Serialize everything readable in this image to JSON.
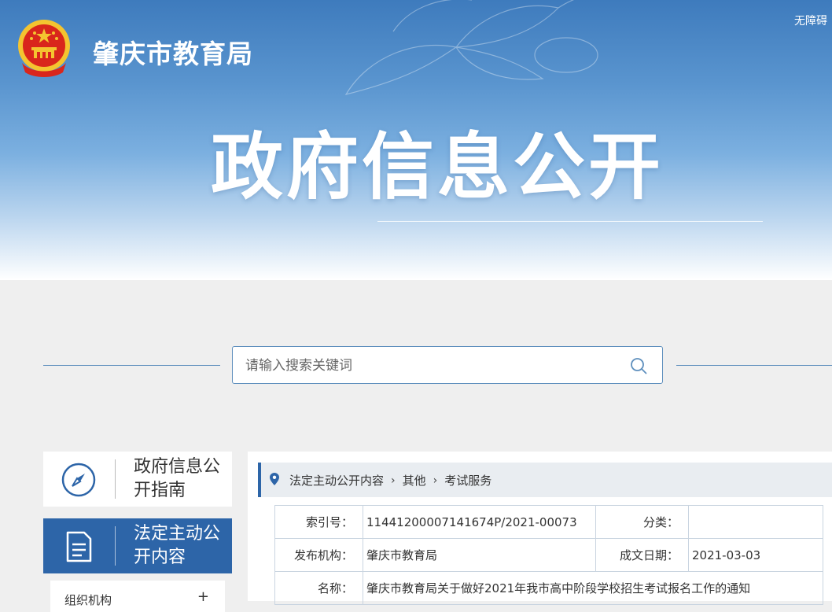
{
  "header": {
    "site_title": "肇庆市教育局",
    "accessibility": "无障碍",
    "hero_title": "政府信息公开"
  },
  "search": {
    "placeholder": "请输入搜索关键词",
    "value": ""
  },
  "sidebar": {
    "guide_label": "政府信息公开指南",
    "active_label": "法定主动公开内容",
    "tree_item": "组织机构",
    "tree_toggle": "+"
  },
  "breadcrumb": {
    "items": [
      "法定主动公开内容",
      "其他",
      "考试服务"
    ],
    "separator": "›"
  },
  "meta": {
    "index_key": "索引号：",
    "index_val": "11441200007141674P/2021-00073",
    "category_key": "分类：",
    "category_val": "",
    "publisher_key": "发布机构：",
    "publisher_val": "肇庆市教育局",
    "date_key": "成文日期：",
    "date_val": "2021-03-03",
    "name_key": "名称：",
    "name_val": "肇庆市教育局关于做好2021年我市高中阶段学校招生考试报名工作的通知"
  },
  "colors": {
    "primary": "#2d65a8",
    "banner_top": "#3e7bbd",
    "line": "#5e8fbd",
    "emblem_red": "#d9261c",
    "emblem_gold": "#f4c430"
  },
  "icons": {
    "guide": "compass-icon",
    "active": "document-icon",
    "search": "search-icon",
    "breadcrumb": "location-pin-icon"
  }
}
